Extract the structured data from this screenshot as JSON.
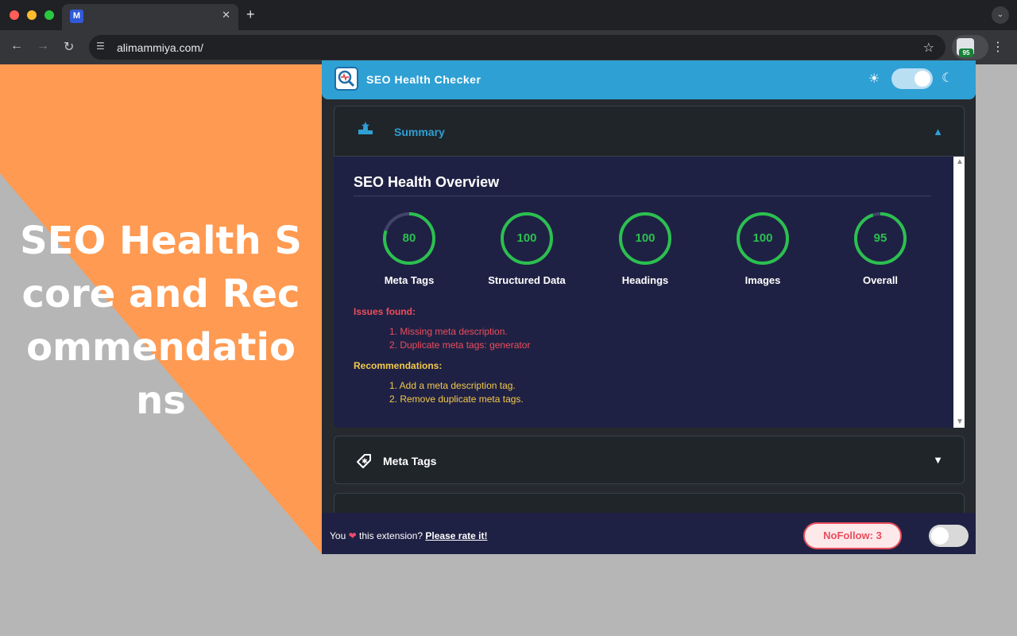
{
  "colors": {
    "orange": "#ff9a52",
    "gray": "#b6b6b6",
    "header_blue": "#2ea0d4",
    "summary_bg": "#1f2144",
    "good_green": "#2bc04f",
    "issue_red": "#ee4d5a",
    "recommend_yellow": "#f2c94c"
  },
  "promo": {
    "text": "SEO Health Score and Recommendations"
  },
  "browser": {
    "tab_favicon": "M",
    "url": "alimammiya.com/",
    "extension_badge": "95",
    "icons": {
      "back": "arrow-left",
      "forward": "arrow-right",
      "reload": "reload",
      "site_settings": "tune",
      "bookmark": "star",
      "menu": "kebab"
    }
  },
  "popup": {
    "title": "SEO Health Checker",
    "summary": {
      "label": "Summary",
      "caret": "▲",
      "overview_title": "SEO Health Overview",
      "scores": [
        {
          "label": "Meta Tags",
          "value": 80
        },
        {
          "label": "Structured Data",
          "value": 100
        },
        {
          "label": "Headings",
          "value": 100
        },
        {
          "label": "Images",
          "value": 100
        },
        {
          "label": "Overall",
          "value": 95
        }
      ],
      "issues_heading": "Issues found:",
      "issues": [
        "1. Missing meta description.",
        "2. Duplicate meta tags: generator"
      ],
      "recommendations_heading": "Recommendations:",
      "recommendations": [
        "1. Add a meta description tag.",
        "2. Remove duplicate meta tags."
      ]
    },
    "meta_tags": {
      "label": "Meta Tags",
      "caret": "▼"
    },
    "footer": {
      "you": "You",
      "this_extension": "this extension?",
      "rate_link": "Please rate it!",
      "nofollow_button": "NoFollow: 3"
    }
  }
}
